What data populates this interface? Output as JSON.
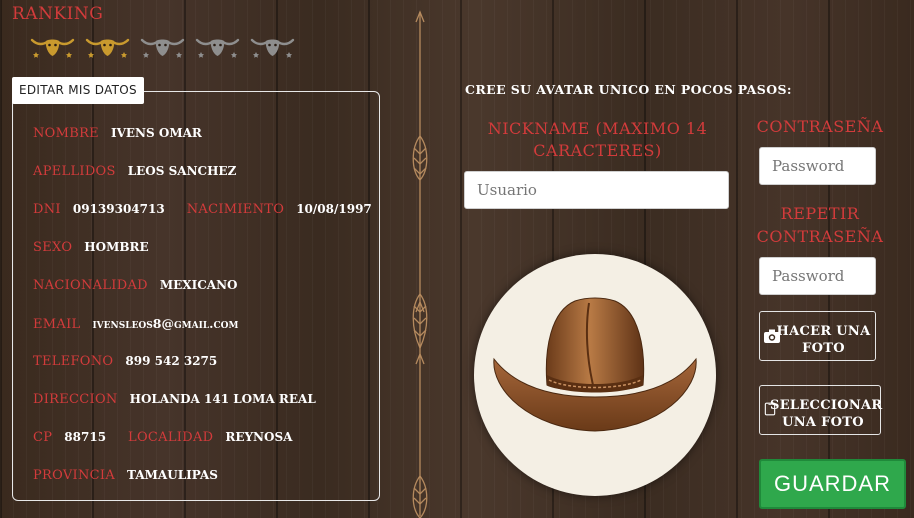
{
  "ranking": {
    "title": "RANKING",
    "icon": "bull-skull-icon",
    "filled": 2,
    "total": 5,
    "colors": {
      "filled": "#c99a2e",
      "empty": "#8e8e8e"
    }
  },
  "profile": {
    "tab_label": "EDITAR MIS DATOS",
    "nombre_label": "NOMBRE",
    "nombre": "IVENS OMAR",
    "apellidos_label": "APELLIDOS",
    "apellidos": "LEOS SANCHEZ",
    "dni_label": "DNI",
    "dni": "09139304713",
    "nacimiento_label": "NACIMIENTO",
    "nacimiento": "10/08/1997",
    "sexo_label": "SEXO",
    "sexo": "HOMBRE",
    "nacionalidad_label": "NACIONALIDAD",
    "nacionalidad": "MEXICANO",
    "email_label": "EMAIL",
    "email": "ivensleos8@gmail.com",
    "telefono_label": "TELEFONO",
    "telefono": "899 542 3275",
    "direccion_label": "DIRECCION",
    "direccion": "HOLANDA 141 LOMA REAL",
    "cp_label": "CP",
    "cp": "88715",
    "localidad_label": "LOCALIDAD",
    "localidad": "REYNOSA",
    "provincia_label": "PROVINCIA",
    "provincia": "TAMAULIPAS"
  },
  "form": {
    "intro": "CREE SU AVATAR UNICO EN POCOS PASOS:",
    "nickname_label": "NICKNAME (MAXIMO 14 CARACTERES)",
    "nickname_placeholder": "Usuario",
    "password_label": "CONTRASEÑA",
    "password_placeholder": "Password",
    "repeat_label": "REPETIR CONTRASEÑA",
    "repeat_placeholder": "Password",
    "take_photo": "HACER UNA FOTO",
    "take_photo_icon": "camera-icon",
    "select_photo": "SELECCIONAR UNA FOTO",
    "select_photo_icon": "phone-icon",
    "save": "GUARDAR",
    "accent_color": "#d23b3b",
    "save_color": "#2fa84c"
  }
}
